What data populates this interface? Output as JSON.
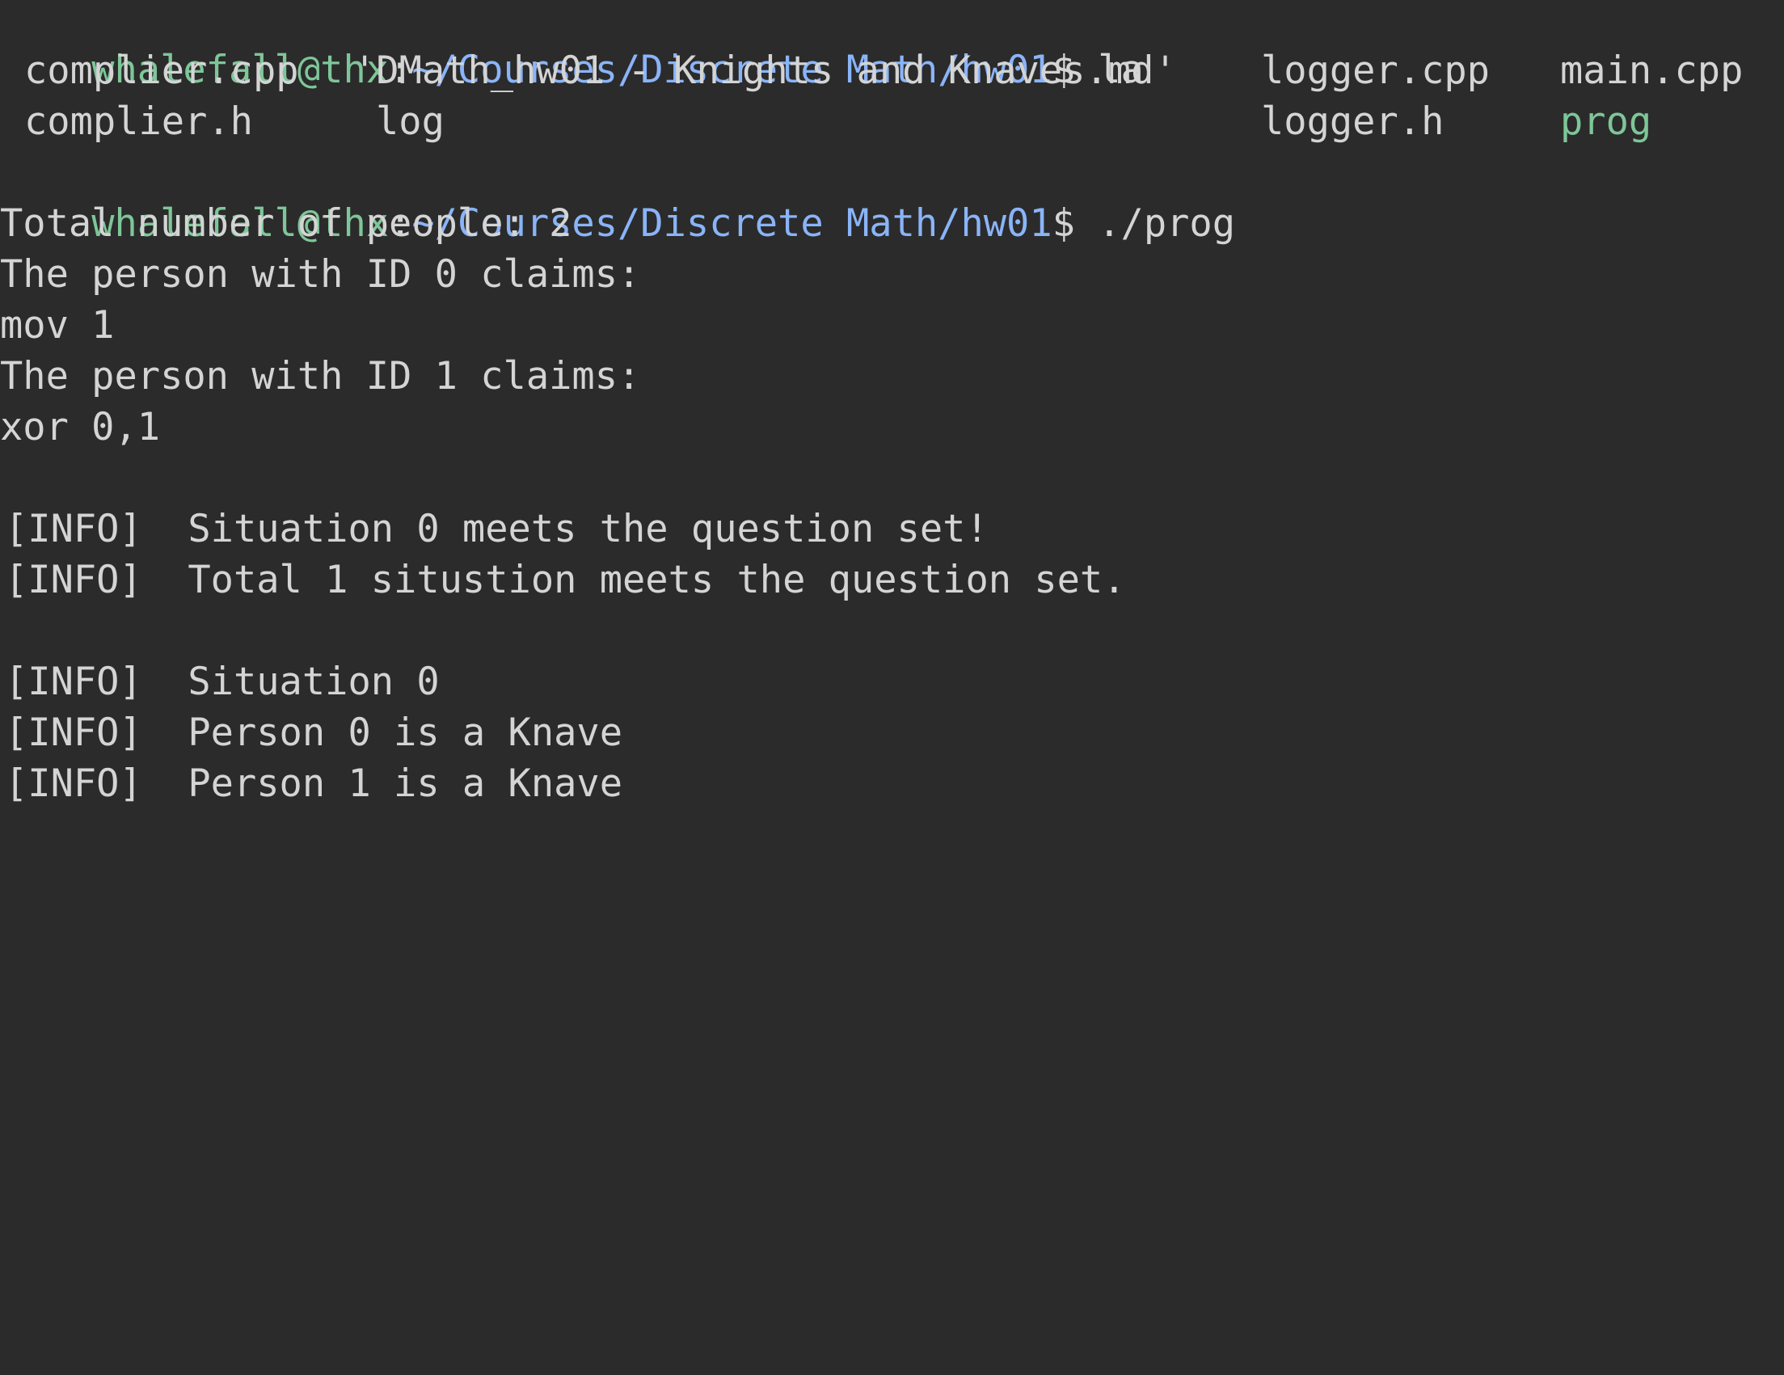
{
  "prompt": {
    "user_host": "whalefall@thx",
    "separator": ":",
    "path": "~/Courses/Discrete Math/hw01",
    "symbol": "$"
  },
  "commands": {
    "first": " la",
    "second": " ./prog"
  },
  "listing": {
    "row1": [
      "complier.cpp",
      "'DMath_hw01 - Knights and Knaves.md'",
      "logger.cpp",
      "main.cpp"
    ],
    "row2": [
      "complier.h",
      "log",
      "logger.h",
      "prog"
    ]
  },
  "output": [
    "Total number of people: 2",
    "The person with ID 0 claims:",
    "mov 1",
    "The person with ID 1 claims:",
    "xor 0,1",
    "",
    "[INFO]  Situation 0 meets the question set!",
    "[INFO]  Total 1 situstion meets the question set.",
    "",
    "[INFO]  Situation 0",
    "[INFO]  Person 0 is a Knave",
    "[INFO]  Person 1 is a Knave"
  ],
  "colors": {
    "background": "#2b2b2b",
    "text": "#d4d4d4",
    "user_host": "#7ec699",
    "path": "#8ab4f8",
    "executable": "#7ec699"
  }
}
